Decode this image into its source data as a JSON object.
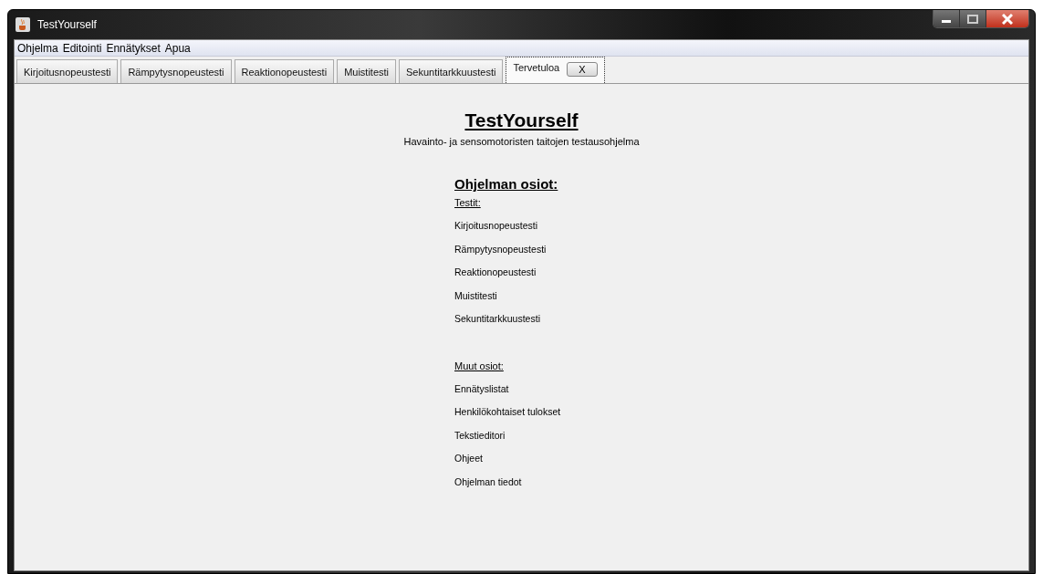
{
  "window": {
    "title": "TestYourself"
  },
  "menu": [
    "Ohjelma",
    "Editointi",
    "Ennätykset",
    "Apua"
  ],
  "tabs": [
    {
      "label": "Kirjoitusnopeustesti",
      "selected": false
    },
    {
      "label": "Rämpytysnopeustesti",
      "selected": false
    },
    {
      "label": "Reaktionopeustesti",
      "selected": false
    },
    {
      "label": "Muistitesti",
      "selected": false
    },
    {
      "label": "Sekuntitarkkuustesti",
      "selected": false
    },
    {
      "label": "Tervetuloa",
      "selected": true,
      "close_button": "X"
    }
  ],
  "content": {
    "title": "TestYourself",
    "subtitle": "Havainto- ja sensomotoristen taitojen testausohjelma",
    "heading": "Ohjelman osiot:",
    "sections": [
      {
        "heading": "Testit:",
        "items": [
          "Kirjoitusnopeustesti",
          "Rämpytysnopeustesti",
          "Reaktionopeustesti",
          "Muistitesti",
          "Sekuntitarkkuustesti"
        ]
      },
      {
        "heading": "Muut osiot:",
        "items": [
          "Ennätyslistat",
          "Henkilökohtaiset tulokset",
          "Tekstieditori",
          "Ohjeet",
          "Ohjelman tiedot"
        ]
      }
    ]
  }
}
